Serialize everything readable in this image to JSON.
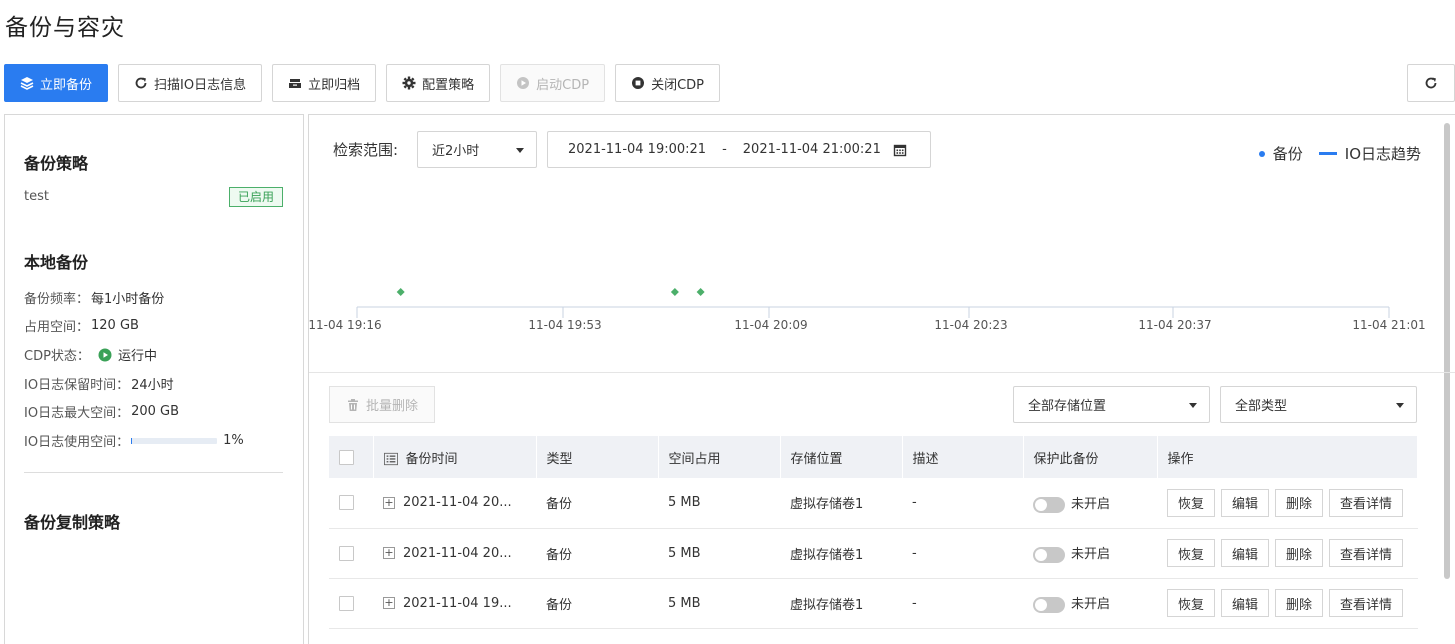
{
  "page": {
    "title": "备份与容灾"
  },
  "toolbar": {
    "backup_now": "立即备份",
    "scan_io": "扫描IO日志信息",
    "archive_now": "立即归档",
    "config_policy": "配置策略",
    "start_cdp": "启动CDP",
    "stop_cdp": "关闭CDP"
  },
  "left": {
    "policy_title": "备份策略",
    "policy_name": "test",
    "policy_status": "已启用",
    "local_title": "本地备份",
    "freq_label": "备份频率：",
    "freq_value": "每1小时备份",
    "space_label": "占用空间：",
    "space_value": "120 GB",
    "cdp_label": "CDP状态：",
    "cdp_value": "运行中",
    "retention_label": "IO日志保留时间：",
    "retention_value": "24小时",
    "max_label": "IO日志最大空间：",
    "max_value": "200 GB",
    "usage_label": "IO日志使用空间：",
    "usage_value": "1%",
    "usage_fraction": 0.01,
    "replication_title": "备份复制策略"
  },
  "filter": {
    "range_label": "检索范围:",
    "range_value": "近2小时",
    "start": "2021-11-04 19:00:21",
    "sep": "-",
    "end": "2021-11-04 21:00:21"
  },
  "legend": {
    "backup": "备份",
    "io_trend": "IO日志趋势"
  },
  "chart_data": {
    "type": "scatter",
    "x_ticks": [
      "11-04 19:16",
      "11-04 19:53",
      "11-04 20:09",
      "11-04 20:23",
      "11-04 20:37",
      "11-04 21:01"
    ],
    "backup_points_color": "#4caf6a",
    "backup_points": [
      "11-04 19:24",
      "11-04 20:02",
      "11-04 20:04"
    ]
  },
  "table_controls": {
    "batch_delete": "批量删除",
    "storage_filter": "全部存储位置",
    "type_filter": "全部类型"
  },
  "table": {
    "headers": [
      "备份时间",
      "类型",
      "空间占用",
      "存储位置",
      "描述",
      "保护此备份",
      "操作"
    ],
    "rows": [
      {
        "time": "2021-11-04 20...",
        "type": "备份",
        "size": "5 MB",
        "location": "虚拟存储卷1",
        "desc": "-",
        "protect": "未开启"
      },
      {
        "time": "2021-11-04 20...",
        "type": "备份",
        "size": "5 MB",
        "location": "虚拟存储卷1",
        "desc": "-",
        "protect": "未开启"
      },
      {
        "time": "2021-11-04 19...",
        "type": "备份",
        "size": "5 MB",
        "location": "虚拟存储卷1",
        "desc": "-",
        "protect": "未开启"
      }
    ],
    "actions": {
      "restore": "恢复",
      "edit": "编辑",
      "delete": "删除",
      "details": "查看详情"
    }
  },
  "colors": {
    "primary": "#2a7cf0",
    "success": "#4caf6a"
  }
}
